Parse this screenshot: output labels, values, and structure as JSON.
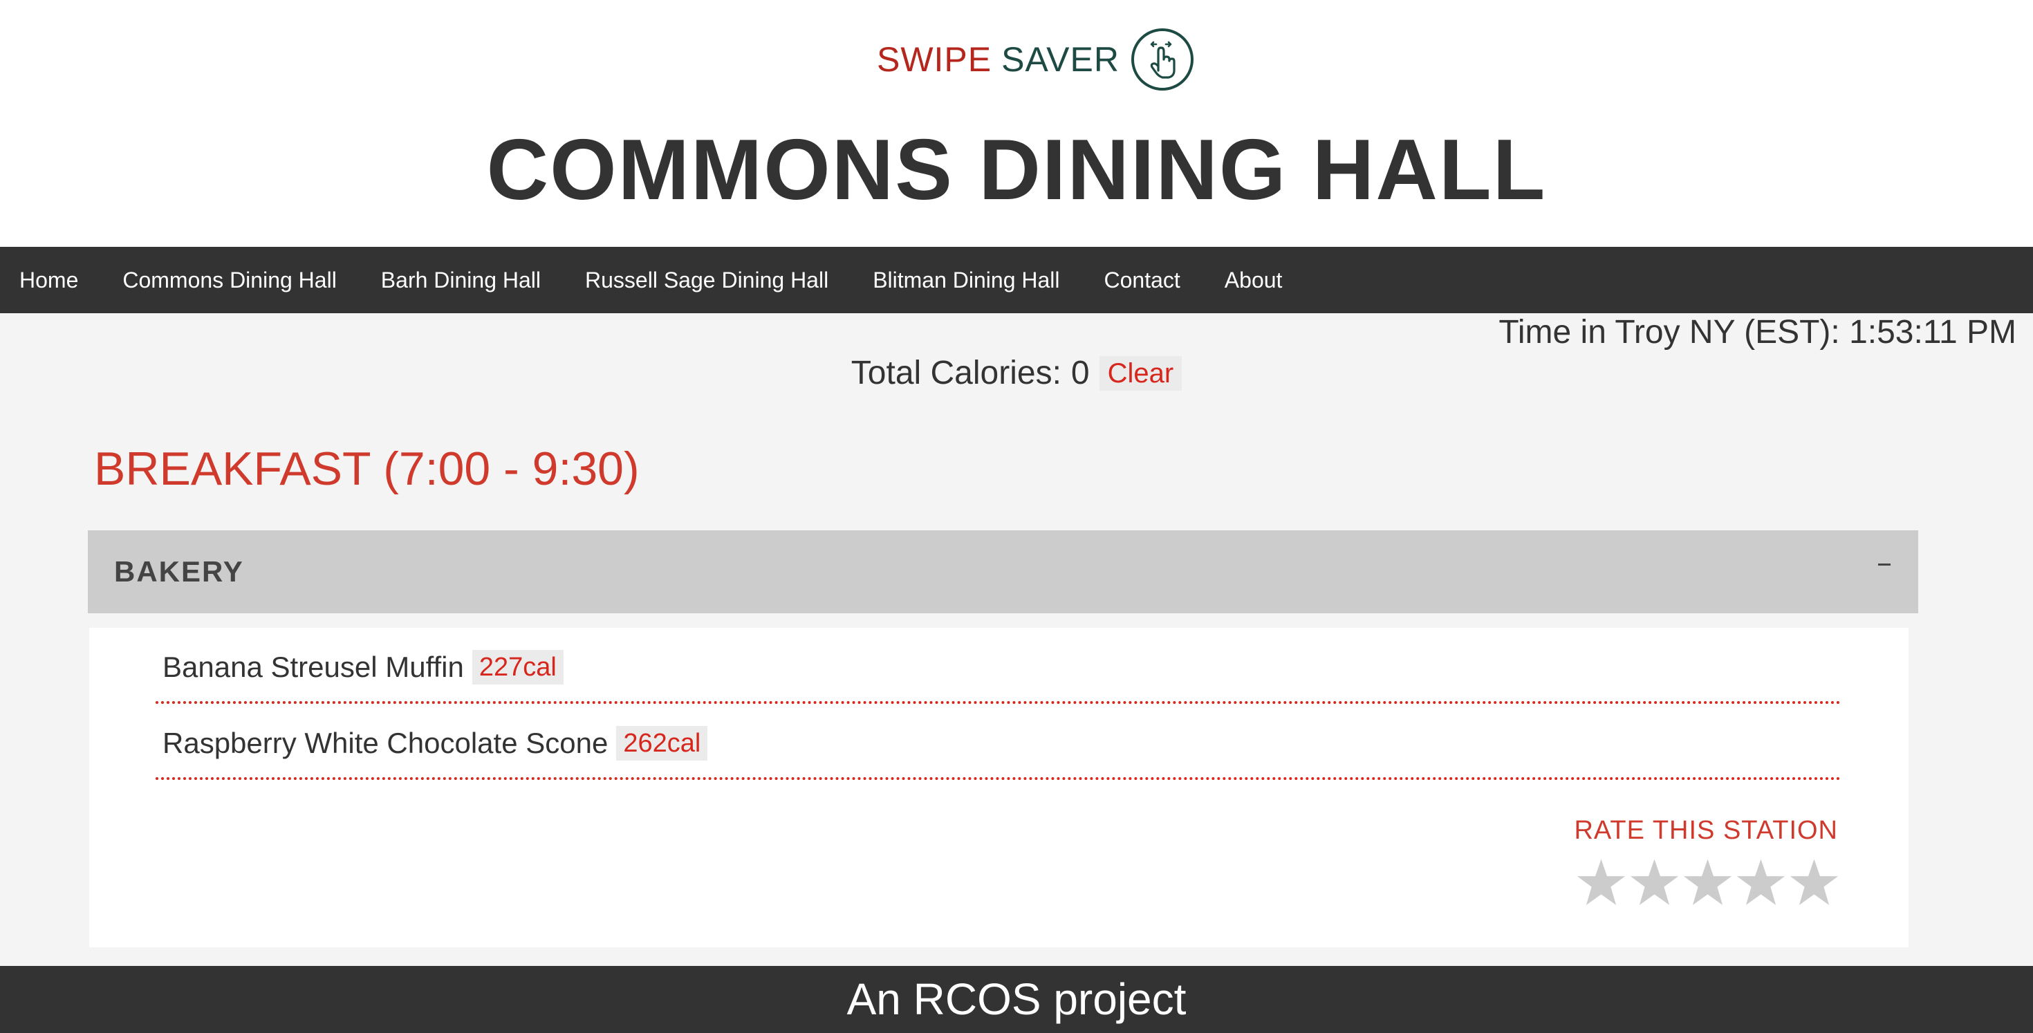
{
  "logo": {
    "word1": "SWIPE",
    "word2": "SAVER",
    "icon": "hand-pointer-icon"
  },
  "page_title": "COMMONS DINING HALL",
  "nav": {
    "items": [
      {
        "label": "Home"
      },
      {
        "label": "Commons Dining Hall"
      },
      {
        "label": "Barh Dining Hall"
      },
      {
        "label": "Russell Sage Dining Hall"
      },
      {
        "label": "Blitman Dining Hall"
      },
      {
        "label": "Contact"
      },
      {
        "label": "About"
      }
    ]
  },
  "time": {
    "text": "Time in Troy NY (EST): 1:53:11 PM"
  },
  "calories": {
    "label": "Total Calories:",
    "value": "0",
    "clear_label": "Clear"
  },
  "meal": {
    "heading": "BREAKFAST (7:00 - 9:30)"
  },
  "station": {
    "name": "BAKERY",
    "collapse_icon": "minus-icon",
    "items": [
      {
        "name": "Banana Streusel Muffin",
        "calories": "227cal"
      },
      {
        "name": "Raspberry White Chocolate Scone",
        "calories": "262cal"
      }
    ],
    "rate_label": "RATE THIS STATION",
    "rating": {
      "value": 0,
      "max": 5
    }
  },
  "footer": {
    "text": "An RCOS project"
  },
  "colors": {
    "accent": "#d7261c",
    "heading_red": "#cf3a2c",
    "brand_red": "#b5271c",
    "brand_green": "#1e4a44",
    "nav_bg": "#333333",
    "star_empty": "#cccccc"
  }
}
